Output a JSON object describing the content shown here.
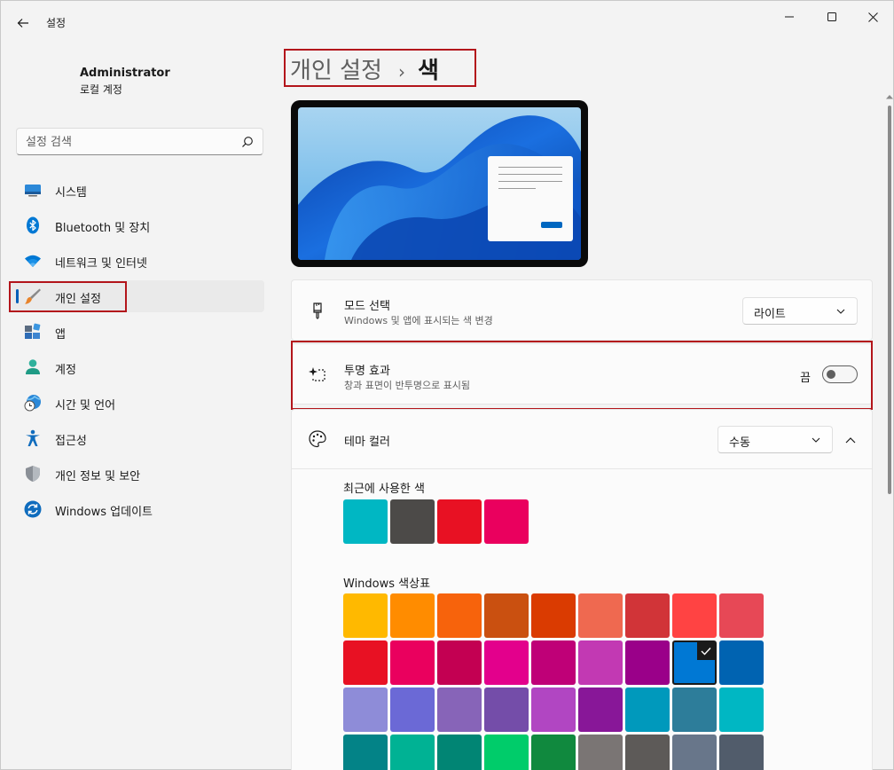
{
  "window": {
    "title": "설정",
    "back_icon": "back-arrow-icon",
    "minimize_icon": "minimize-icon",
    "maximize_icon": "maximize-icon",
    "close_icon": "close-icon"
  },
  "user": {
    "name": "Administrator",
    "account_type": "로컬 계정"
  },
  "search": {
    "placeholder": "설정 검색",
    "icon": "search-icon"
  },
  "sidebar": {
    "items": [
      {
        "label": "시스템",
        "icon": "system-icon",
        "active": false
      },
      {
        "label": "Bluetooth 및 장치",
        "icon": "bluetooth-icon",
        "active": false
      },
      {
        "label": "네트워크 및 인터넷",
        "icon": "wifi-icon",
        "active": false
      },
      {
        "label": "개인 설정",
        "icon": "brush-icon",
        "active": true
      },
      {
        "label": "앱",
        "icon": "apps-icon",
        "active": false
      },
      {
        "label": "계정",
        "icon": "account-icon",
        "active": false
      },
      {
        "label": "시간 및 언어",
        "icon": "time-language-icon",
        "active": false
      },
      {
        "label": "접근성",
        "icon": "accessibility-icon",
        "active": false
      },
      {
        "label": "개인 정보 및 보안",
        "icon": "shield-icon",
        "active": false
      },
      {
        "label": "Windows 업데이트",
        "icon": "update-icon",
        "active": false
      }
    ]
  },
  "breadcrumb": {
    "parent": "개인 설정",
    "separator": "›",
    "current": "색"
  },
  "mode": {
    "title": "모드 선택",
    "subtitle": "Windows 및 앱에 표시되는 색 변경",
    "value": "라이트",
    "icon": "brush-mode-icon"
  },
  "transparency": {
    "title": "투명 효과",
    "subtitle": "창과 표면이 반투명으로 표시됨",
    "state_label": "끔",
    "on": false,
    "icon": "transparency-sparkle-icon"
  },
  "theme_color": {
    "title": "테마 컬러",
    "value": "수동",
    "icon": "palette-icon",
    "expanded": true
  },
  "recent_colors": {
    "label": "최근에 사용한 색",
    "colors": [
      "#00b7c3",
      "#4c4a48",
      "#e81123",
      "#ea005e"
    ]
  },
  "windows_palette": {
    "label": "Windows 색상표",
    "selected": "#0078d4",
    "rows": [
      [
        "#ffb900",
        "#ff8c00",
        "#f7630c",
        "#ca5010",
        "#da3b01",
        "#ef6950",
        "#d13438",
        "#ff4343",
        "#e74856"
      ],
      [
        "#e81123",
        "#ea005e",
        "#c30052",
        "#e3008c",
        "#bf0077",
        "#c239b3",
        "#9a0089",
        "#0078d4",
        "#0063b1"
      ],
      [
        "#8e8cd8",
        "#6b69d6",
        "#8764b8",
        "#744da9",
        "#b146c2",
        "#881798",
        "#0099bc",
        "#2d7d9a",
        "#00b7c3"
      ],
      [
        "#038387",
        "#00b294",
        "#018574",
        "#00cc6a",
        "#10893e",
        "#7a7574",
        "#5d5a58",
        "#68768a",
        "#515c6b"
      ]
    ]
  }
}
